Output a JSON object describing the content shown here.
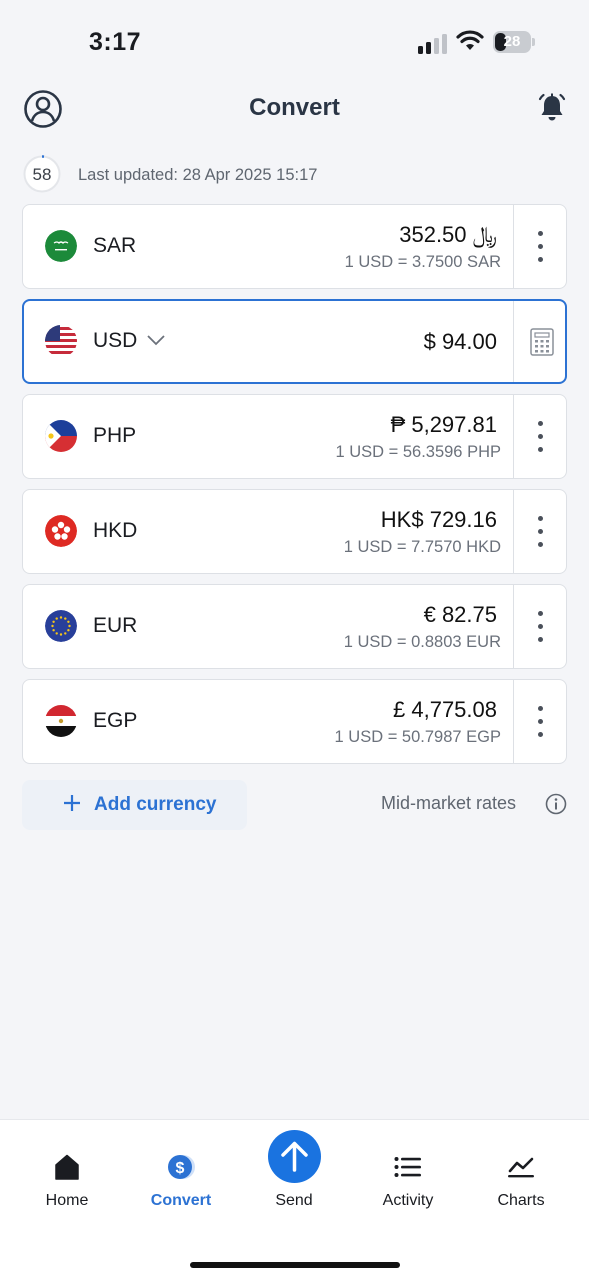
{
  "status_bar": {
    "time": "3:17",
    "battery": "28"
  },
  "header": {
    "title": "Convert"
  },
  "updated": {
    "countdown": "58",
    "text": "Last updated: 28 Apr 2025 15:17"
  },
  "currencies": [
    {
      "code": "SAR",
      "amount": "352.50 ﷼",
      "rate": "1 USD = 3.7500 SAR"
    },
    {
      "code": "USD",
      "amount": "$ 94.00"
    },
    {
      "code": "PHP",
      "amount": "₱ 5,297.81",
      "rate": "1 USD = 56.3596 PHP"
    },
    {
      "code": "HKD",
      "amount": "HK$ 729.16",
      "rate": "1 USD = 7.7570 HKD"
    },
    {
      "code": "EUR",
      "amount": "€ 82.75",
      "rate": "1 USD = 0.8803 EUR"
    },
    {
      "code": "EGP",
      "amount": "£ 4,775.08",
      "rate": "1 USD = 50.7987 EGP"
    }
  ],
  "actions": {
    "add_currency": "Add currency",
    "mid_market": "Mid-market rates"
  },
  "tabs": [
    {
      "label": "Home"
    },
    {
      "label": "Convert"
    },
    {
      "label": "Send"
    },
    {
      "label": "Activity"
    },
    {
      "label": "Charts"
    }
  ],
  "colors": {
    "accent": "#2c72d3",
    "send_button": "#1a73e0",
    "background": "#f4f5f8"
  }
}
